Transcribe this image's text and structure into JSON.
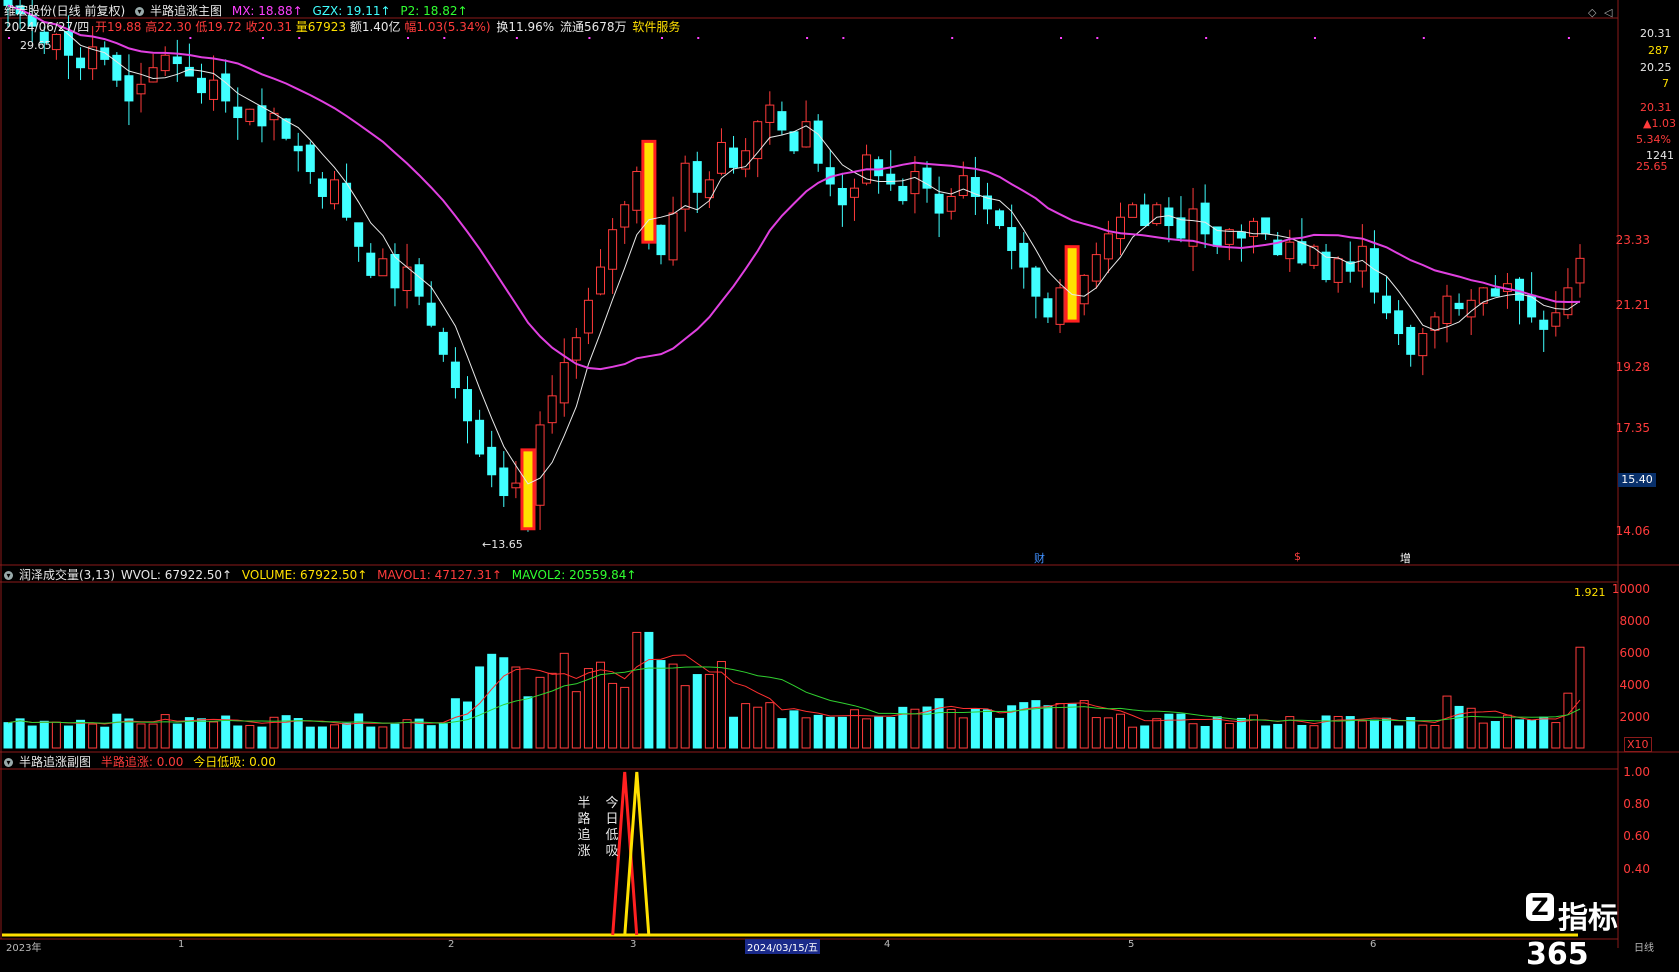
{
  "main_header": {
    "stock": "维宏股份(日线 前复权)",
    "indicator": "半路追涨主图",
    "mx": "MX: 18.88↑",
    "gzx": "GZX: 19.11↑",
    "p2": "P2: 18.82↑"
  },
  "info_line": {
    "date": "2024/06/27/四",
    "open": "开19.88",
    "high": "高22.30",
    "low": "低19.72",
    "close": "收20.31",
    "vol": "量67923",
    "amount": "额1.40亿",
    "change": "幅1.03(5.34%)",
    "turnover": "换11.96%",
    "float": "流通5678万",
    "sector": "软件服务"
  },
  "price_axis": [
    "23.33",
    "21.21",
    "19.28",
    "17.35",
    "14.06"
  ],
  "price_marker": "15.40",
  "right_panel": {
    "v1": "20.31",
    "v2": "287",
    "v3": "20.25",
    "v4": "7",
    "v5": "20.31",
    "v6": "▲1.03",
    "v7": "5.34%",
    "v8": "1241",
    "v9": "25.65"
  },
  "annotations": {
    "high": "29.65",
    "low": "←13.65"
  },
  "events": [
    "财",
    "$",
    "增"
  ],
  "vol_header": {
    "name": "润泽成交量(3,13)",
    "wvol": "WVOL: 67922.50↑",
    "volume": "VOLUME: 67922.50↑",
    "mavol1": "MAVOL1: 47127.31↑",
    "mavol2": "MAVOL2: 20559.84↑"
  },
  "vol_axis": [
    "10000",
    "8000",
    "6000",
    "4000",
    "2000"
  ],
  "vol_ratio": "1.921",
  "vol_unit": "X10",
  "sub_header": {
    "name": "半路追涨副图",
    "v1": "半路追涨: 0.00",
    "v2": "今日低吸: 0.00"
  },
  "sub_axis": [
    "1.00",
    "0.80",
    "0.60",
    "0.40"
  ],
  "sub_labels": {
    "a": "半路追涨",
    "b": "今日低吸"
  },
  "x_axis": {
    "start": "2023年",
    "mid": "2024/03/15/五",
    "end": "日线",
    "t1": "1",
    "t2": "2",
    "t3": "3",
    "t4": "4",
    "t5": "5",
    "t6": "6"
  },
  "watermark": {
    "logo": "Z",
    "text": "指标365"
  },
  "colors": {
    "up": "#ff3b3b",
    "down": "#40ffff",
    "ma_short": "#e8e8e8",
    "ma_long": "#e040e0",
    "vol_ma1": "#ff3030",
    "vol_ma2": "#30d030",
    "signal_red": "#ff2020",
    "signal_yellow": "#ffe000"
  },
  "chart_data": {
    "type": "candlestick",
    "ylim": [
      13.0,
      26.0
    ],
    "closes": [
      26.4,
      26.2,
      25.9,
      25.5,
      25.7,
      25.2,
      24.9,
      25.4,
      25.1,
      24.6,
      24.1,
      24.5,
      24.9,
      25.2,
      25.0,
      24.7,
      24.3,
      24.6,
      24.1,
      23.7,
      23.9,
      23.5,
      23.8,
      23.2,
      22.9,
      22.4,
      21.8,
      22.2,
      21.3,
      20.6,
      19.9,
      20.3,
      19.6,
      20.1,
      19.4,
      18.7,
      18.0,
      17.2,
      16.4,
      15.6,
      15.1,
      14.6,
      14.9,
      14.2,
      16.3,
      17.0,
      17.8,
      18.4,
      19.3,
      20.1,
      21.0,
      21.6,
      22.4,
      21.1,
      20.4,
      21.4,
      22.6,
      21.9,
      22.2,
      23.1,
      22.5,
      22.9,
      23.6,
      24.0,
      23.4,
      22.9,
      23.6,
      22.6,
      22.1,
      21.6,
      22.0,
      22.8,
      22.3,
      22.1,
      21.7,
      22.4,
      22.0,
      21.4,
      21.8,
      22.3,
      21.8,
      21.5,
      21.1,
      20.5,
      20.1,
      19.4,
      18.9,
      19.6,
      19.2,
      19.9,
      20.4,
      20.9,
      21.3,
      21.6,
      21.1,
      21.6,
      21.1,
      20.8,
      21.5,
      20.9,
      20.6,
      21.0,
      20.8,
      21.2,
      20.9,
      20.4,
      20.7,
      20.2,
      20.6,
      19.8,
      20.3,
      20.0,
      20.6,
      19.5,
      19.0,
      18.5,
      18.0,
      18.5,
      18.9,
      19.4,
      19.1,
      19.3,
      19.6,
      19.4,
      19.7,
      19.3,
      18.9,
      18.6,
      19.0,
      19.6,
      20.31
    ]
  }
}
